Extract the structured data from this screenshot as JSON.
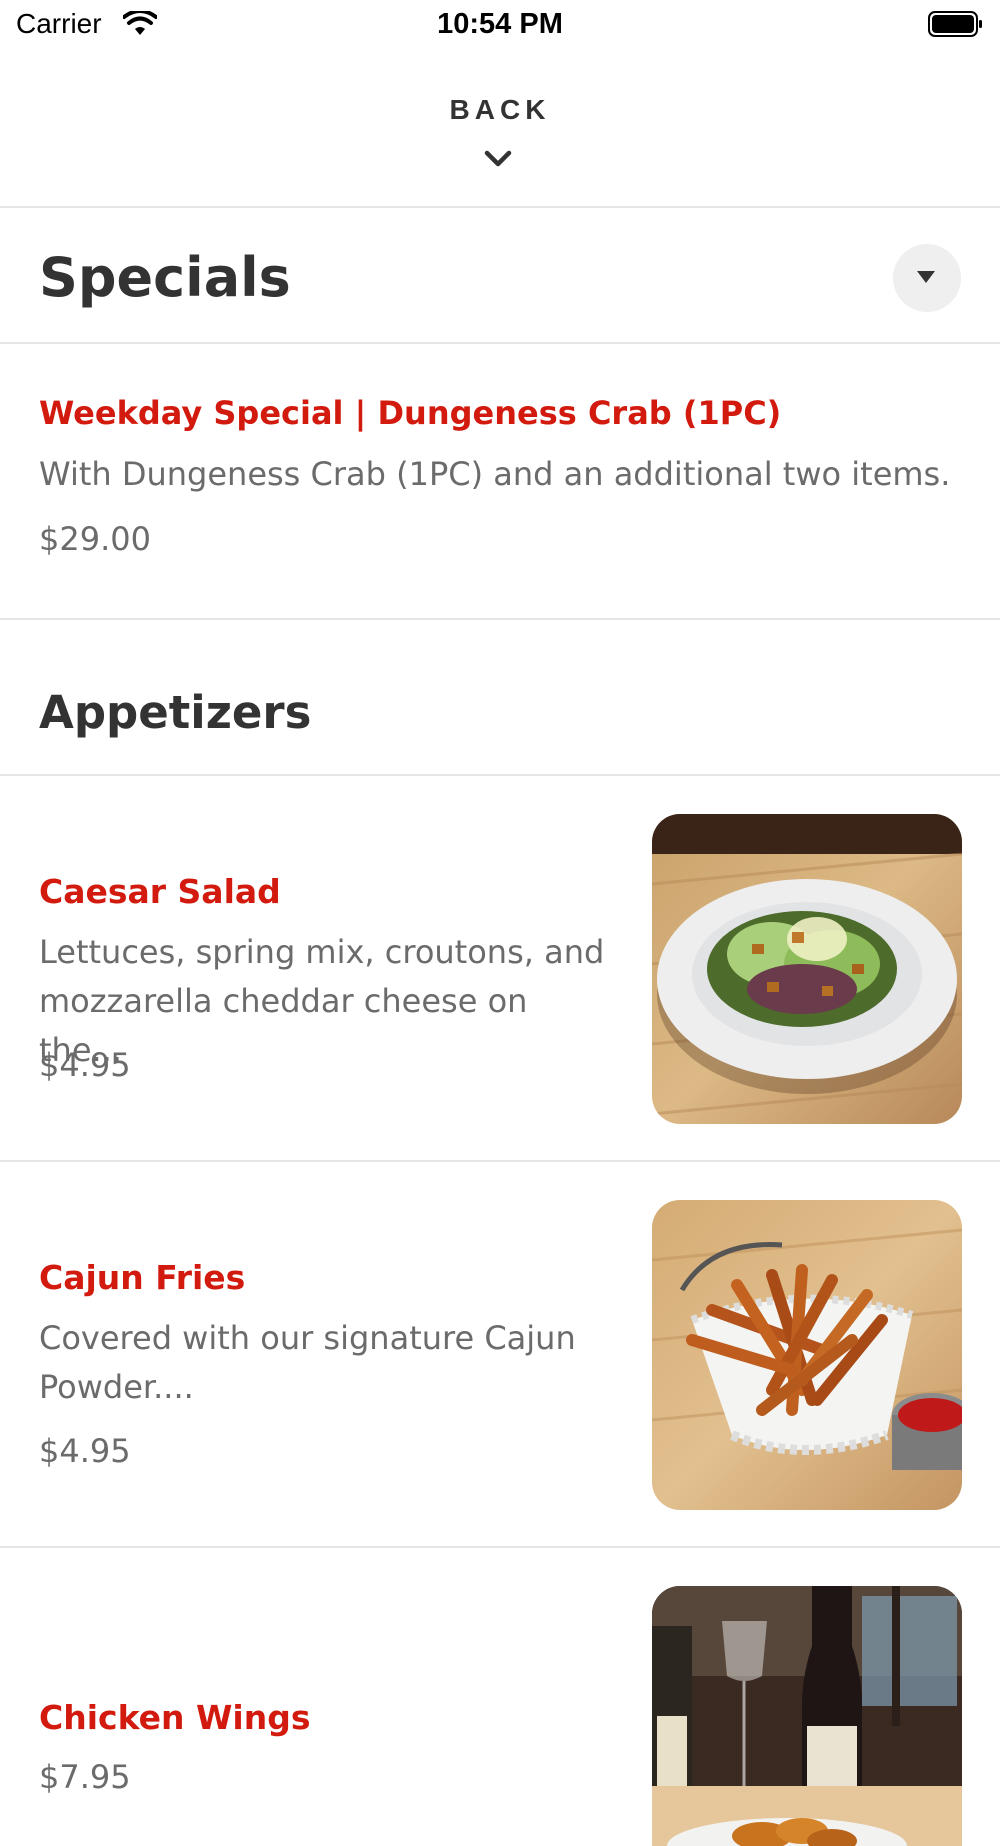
{
  "status_bar": {
    "carrier": "Carrier",
    "time": "10:54 PM"
  },
  "nav": {
    "back_label": "BACK"
  },
  "specials": {
    "title": "Specials",
    "items": [
      {
        "name": "Weekday Special | Dungeness Crab (1PC)",
        "description": "With Dungeness Crab (1PC) and an additional two items.",
        "price": "$29.00"
      }
    ]
  },
  "appetizers": {
    "title": "Appetizers",
    "items": [
      {
        "name": "Caesar Salad",
        "description": "Lettuces, spring mix, croutons, and mozzarella cheddar cheese on the...",
        "price": "$4.95",
        "photo": "caesar-salad-photo"
      },
      {
        "name": "Cajun Fries",
        "description": "Covered with our signature Cajun Powder....",
        "price": "$4.95",
        "photo": "cajun-fries-photo"
      },
      {
        "name": "Chicken Wings",
        "price": "$7.95",
        "photo": "chicken-wings-photo"
      }
    ]
  },
  "colors": {
    "accent": "#d21b0e",
    "text": "#333333",
    "muted": "#6b6b6b",
    "divider": "#e6e6e6"
  }
}
